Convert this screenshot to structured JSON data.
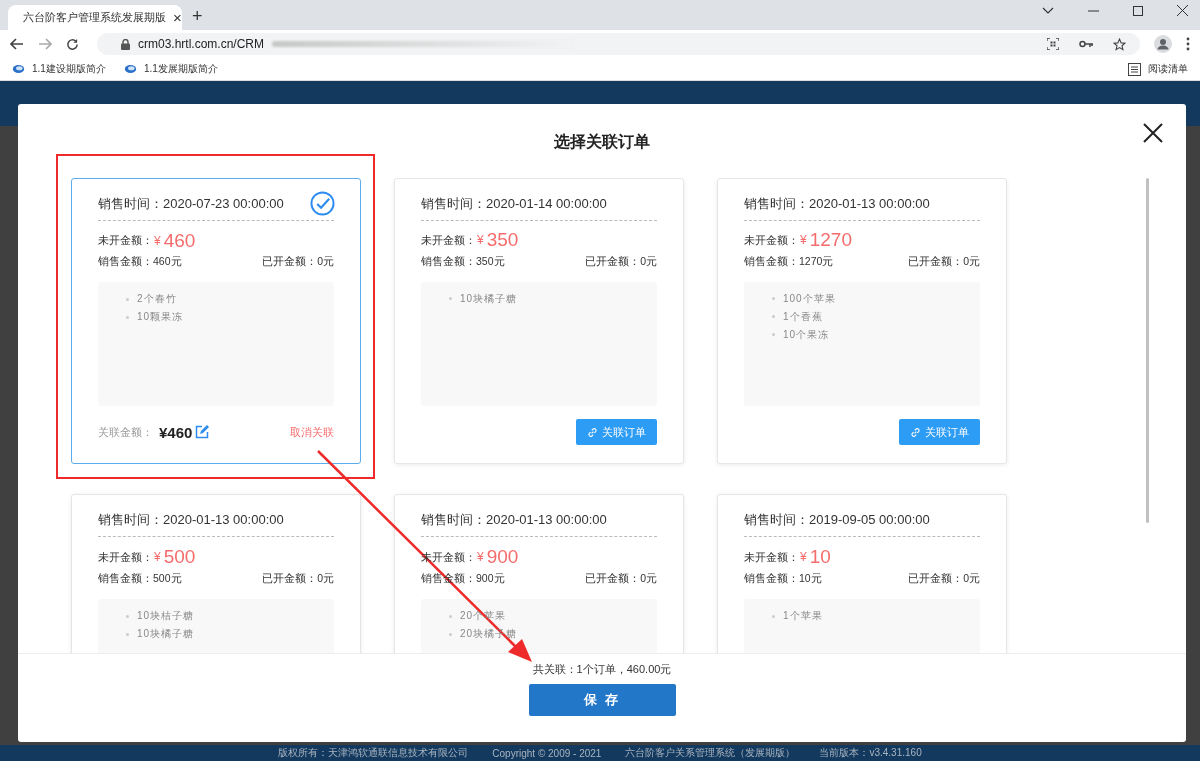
{
  "browser": {
    "tab": {
      "title": "六台阶客户管理系统发展期版",
      "close": "×"
    },
    "new_tab": "+",
    "address": "crm03.hrtl.com.cn/CRM",
    "bookmarks": [
      {
        "label": "1.1建设期版简介"
      },
      {
        "label": "1.1发展期版简介"
      }
    ],
    "reading_list": "阅读清单"
  },
  "dialog": {
    "title": "选择关联订单",
    "cards": [
      {
        "selected": true,
        "sale_time": "销售时间：2020-07-23 00:00:00",
        "uninvoiced_label": "未开金额：",
        "currency": "¥",
        "uninvoiced": "460",
        "sales": "销售金额：460元",
        "invoiced": "已开金额：0元",
        "items": [
          "2个春竹",
          "10颗果冻"
        ],
        "linked_label": "关联金额：",
        "linked_amount": "¥460",
        "action": "取消关联"
      },
      {
        "selected": false,
        "sale_time": "销售时间：2020-01-14 00:00:00",
        "uninvoiced_label": "未开金额：",
        "currency": "¥",
        "uninvoiced": "350",
        "sales": "销售金额：350元",
        "invoiced": "已开金额：0元",
        "items": [
          "10块橘子糖"
        ],
        "action": "关联订单"
      },
      {
        "selected": false,
        "sale_time": "销售时间：2020-01-13 00:00:00",
        "uninvoiced_label": "未开金额：",
        "currency": "¥",
        "uninvoiced": "1270",
        "sales": "销售金额：1270元",
        "invoiced": "已开金额：0元",
        "items": [
          "100个苹果",
          "1个香蕉",
          "10个果冻"
        ],
        "action": "关联订单"
      },
      {
        "selected": false,
        "sale_time": "销售时间：2020-01-13 00:00:00",
        "uninvoiced_label": "未开金额：",
        "currency": "¥",
        "uninvoiced": "500",
        "sales": "销售金额：500元",
        "invoiced": "已开金额：0元",
        "items": [
          "10块桔子糖",
          "10块橘子糖"
        ]
      },
      {
        "selected": false,
        "sale_time": "销售时间：2020-01-13 00:00:00",
        "uninvoiced_label": "未开金额：",
        "currency": "¥",
        "uninvoiced": "900",
        "sales": "销售金额：900元",
        "invoiced": "已开金额：0元",
        "items": [
          "20个苹果",
          "20块橘子糖"
        ]
      },
      {
        "selected": false,
        "sale_time": "销售时间：2019-09-05 00:00:00",
        "uninvoiced_label": "未开金额：",
        "currency": "¥",
        "uninvoiced": "10",
        "sales": "销售金额：10元",
        "invoiced": "已开金额：0元",
        "items": [
          "1个苹果"
        ]
      }
    ],
    "summary": "共关联：1个订单，460.00元",
    "save": "保 存"
  },
  "footer": [
    "版权所有：天津鸿软通联信息技术有限公司",
    "Copyright © 2009 - 2021",
    "六台阶客户关系管理系统（发展期版）",
    "当前版本：v3.4.31.160"
  ]
}
